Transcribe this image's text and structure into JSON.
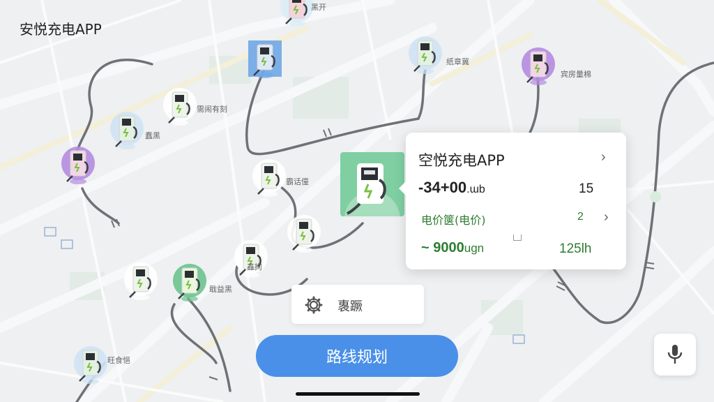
{
  "app": {
    "title": "安悦充电APP"
  },
  "map": {
    "stations": [
      {
        "label": "黑开",
        "variant": "pink"
      },
      {
        "label": "",
        "variant": "blue-square"
      },
      {
        "label": "纸章冀",
        "variant": "blue"
      },
      {
        "label": "宾房量棉",
        "variant": "purple"
      },
      {
        "label": "需闹有刻",
        "variant": "white"
      },
      {
        "label": "蠢黑",
        "variant": "blue"
      },
      {
        "label": "",
        "variant": "purple"
      },
      {
        "label": "霸话僮",
        "variant": "white"
      },
      {
        "label": "",
        "variant": "white"
      },
      {
        "label": "鑫拘",
        "variant": "white"
      },
      {
        "label": "",
        "variant": "white"
      },
      {
        "label": "戢益黑",
        "variant": "green"
      },
      {
        "label": "旺食悒",
        "variant": "blue"
      }
    ]
  },
  "popup": {
    "title": "空悦充电APP",
    "main_value": "-34+00",
    "main_unit": ".ɯb",
    "count": "15",
    "price_label": "电价箧(电价)",
    "price_value": "2",
    "range_value": "~ 9000",
    "range_unit": "ugn",
    "power": "125lh"
  },
  "filter": {
    "label": "褢蹶",
    "icon": "gear-icon"
  },
  "route_button": {
    "label": "路线规划"
  },
  "mic": {
    "icon": "microphone-icon"
  },
  "colors": {
    "accent": "#4a90e8",
    "green": "#2e7d32",
    "selected": "#7fcfa3"
  }
}
